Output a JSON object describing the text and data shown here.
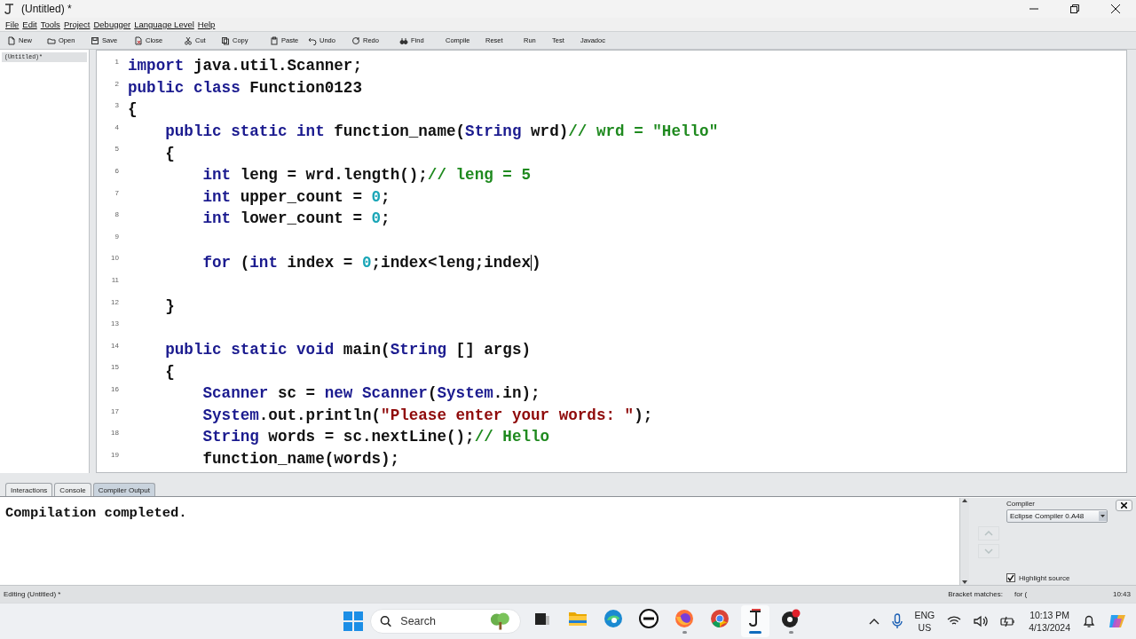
{
  "window": {
    "title": "(Untitled) *"
  },
  "menu": [
    "File",
    "Edit",
    "Tools",
    "Project",
    "Debugger",
    "Language Level",
    "Help"
  ],
  "toolbar": [
    {
      "label": "New",
      "kind": "icon"
    },
    {
      "label": "Open",
      "kind": "icon"
    },
    {
      "label": "Save",
      "kind": "icon"
    },
    {
      "label": "Close",
      "kind": "icon"
    },
    {
      "label": "Cut",
      "kind": "icon"
    },
    {
      "label": "Copy",
      "kind": "icon"
    },
    {
      "label": "Paste",
      "kind": "icon"
    },
    {
      "label": "Undo",
      "kind": "icon"
    },
    {
      "label": "Redo",
      "kind": "icon"
    },
    {
      "label": "Find",
      "kind": "icon"
    },
    {
      "label": "Compile",
      "kind": "text"
    },
    {
      "label": "Reset",
      "kind": "text"
    },
    {
      "label": "Run",
      "kind": "text"
    },
    {
      "label": "Test",
      "kind": "text"
    },
    {
      "label": "Javadoc",
      "kind": "text"
    }
  ],
  "documents": [
    {
      "label": "(Untitled)*",
      "selected": true
    }
  ],
  "code_lines": [
    {
      "number": "1",
      "tokens": [
        {
          "kind": "keyword",
          "text": "import"
        },
        {
          "kind": "plain",
          "text": " java.util.Scanner;"
        }
      ]
    },
    {
      "number": "2",
      "tokens": [
        {
          "kind": "keyword",
          "text": "public"
        },
        {
          "kind": "keyword",
          "text": " class"
        },
        {
          "kind": "plain",
          "text": " Function0123"
        }
      ]
    },
    {
      "number": "3",
      "tokens": [
        {
          "kind": "plain",
          "text": "{"
        }
      ]
    },
    {
      "number": "4",
      "tokens": [
        {
          "kind": "keyword",
          "text": "    public"
        },
        {
          "kind": "keyword",
          "text": " static"
        },
        {
          "kind": "keyword",
          "text": " int"
        },
        {
          "kind": "plain",
          "text": " function_name("
        },
        {
          "kind": "keyword",
          "text": "String"
        },
        {
          "kind": "plain",
          "text": " wrd)"
        },
        {
          "kind": "comment",
          "text": "// wrd = \"Hello\""
        }
      ]
    },
    {
      "number": "5",
      "tokens": [
        {
          "kind": "plain",
          "text": "    {"
        }
      ]
    },
    {
      "number": "6",
      "tokens": [
        {
          "kind": "keyword",
          "text": "        int"
        },
        {
          "kind": "plain",
          "text": " leng = wrd.length();"
        },
        {
          "kind": "comment",
          "text": "// leng = 5"
        }
      ]
    },
    {
      "number": "7",
      "tokens": [
        {
          "kind": "keyword",
          "text": "        int"
        },
        {
          "kind": "plain",
          "text": " upper_count = "
        },
        {
          "kind": "number",
          "text": "0"
        },
        {
          "kind": "plain",
          "text": ";"
        }
      ]
    },
    {
      "number": "8",
      "tokens": [
        {
          "kind": "keyword",
          "text": "        int"
        },
        {
          "kind": "plain",
          "text": " lower_count = "
        },
        {
          "kind": "number",
          "text": "0"
        },
        {
          "kind": "plain",
          "text": ";"
        }
      ]
    },
    {
      "number": "9"
    },
    {
      "number": "10",
      "tokens": [
        {
          "kind": "keyword",
          "text": "        for"
        },
        {
          "kind": "plain",
          "text": " ("
        },
        {
          "kind": "keyword",
          "text": "int"
        },
        {
          "kind": "plain",
          "text": " index = "
        },
        {
          "kind": "number",
          "text": "0"
        },
        {
          "kind": "plain",
          "text": ";index<leng;index"
        },
        {
          "kind": "caret"
        },
        {
          "kind": "plain",
          "text": ")"
        }
      ]
    },
    {
      "number": "11"
    },
    {
      "number": "12",
      "tokens": [
        {
          "kind": "plain",
          "text": "    }"
        }
      ]
    },
    {
      "number": "13"
    },
    {
      "number": "14",
      "tokens": [
        {
          "kind": "keyword",
          "text": "    public"
        },
        {
          "kind": "keyword",
          "text": " static"
        },
        {
          "kind": "keyword",
          "text": " void"
        },
        {
          "kind": "plain",
          "text": " main("
        },
        {
          "kind": "keyword",
          "text": "String"
        },
        {
          "kind": "plain",
          "text": " [] args)"
        }
      ]
    },
    {
      "number": "15",
      "tokens": [
        {
          "kind": "plain",
          "text": "    {"
        }
      ]
    },
    {
      "number": "16",
      "tokens": [
        {
          "kind": "keyword",
          "text": "        Scanner"
        },
        {
          "kind": "plain",
          "text": " sc = "
        },
        {
          "kind": "keyword",
          "text": "new"
        },
        {
          "kind": "keyword",
          "text": " Scanner"
        },
        {
          "kind": "plain",
          "text": "("
        },
        {
          "kind": "keyword",
          "text": "System"
        },
        {
          "kind": "plain",
          "text": ".in);"
        }
      ]
    },
    {
      "number": "17",
      "tokens": [
        {
          "kind": "keyword",
          "text": "        System"
        },
        {
          "kind": "plain",
          "text": ".out.println("
        },
        {
          "kind": "string",
          "text": "\"Please enter your words: \""
        },
        {
          "kind": "plain",
          "text": ");"
        }
      ]
    },
    {
      "number": "18",
      "tokens": [
        {
          "kind": "keyword",
          "text": "        String"
        },
        {
          "kind": "plain",
          "text": " words = sc.nextLine();"
        },
        {
          "kind": "comment",
          "text": "// Hello"
        }
      ]
    },
    {
      "number": "19",
      "tokens": [
        {
          "kind": "plain",
          "text": "        function_name(words);"
        }
      ]
    }
  ],
  "bottom_tabs": [
    {
      "label": "Interactions",
      "selected": false
    },
    {
      "label": "Console",
      "selected": false
    },
    {
      "label": "Compiler Output",
      "selected": true
    }
  ],
  "output": "Compilation completed.",
  "compiler_panel": {
    "label": "Compiler",
    "compiler": "Eclipse Compiler 0.A48",
    "highlight_source": {
      "label": "Highlight source",
      "checked": true
    },
    "up_disabled": true,
    "down_disabled": true
  },
  "status_bar": {
    "message": "Editing (Untitled) *",
    "bracket_label": "Bracket matches:",
    "bracket_value": "for (",
    "position": "10:43"
  },
  "taskbar": {
    "search_placeholder": "Search",
    "apps": [
      {
        "running": false,
        "selected": false
      },
      {
        "running": false,
        "selected": false
      },
      {
        "running": false,
        "selected": false
      },
      {
        "running": false,
        "selected": false
      },
      {
        "running": true,
        "selected": false
      },
      {
        "running": false,
        "selected": false
      },
      {
        "running": true,
        "selected": true
      },
      {
        "running": true,
        "selected": false
      }
    ],
    "language": "ENG",
    "region": "US",
    "time": "10:13 PM",
    "date": "4/13/2024"
  }
}
